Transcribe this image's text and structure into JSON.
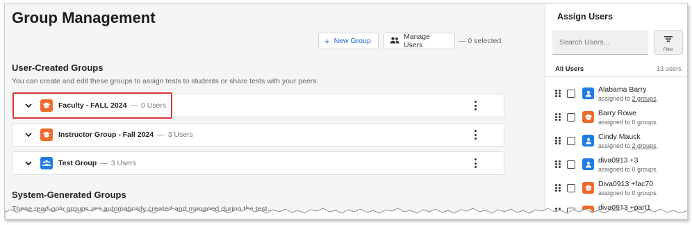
{
  "page": {
    "title": "Group Management",
    "new_group_label": "New Group",
    "manage_users_label": "Manage Users",
    "selected_text": "— 0 selected"
  },
  "user_groups": {
    "title": "User-Created Groups",
    "description": "You can create and edit these groups to assign tests to students or share tests with your peers.",
    "rows": [
      {
        "name": "Faculty - FALL 2024",
        "count": "0 Users",
        "icon": "graduation-cap-icon",
        "color": "#ee6b2d"
      },
      {
        "name": "Instructor Group - Fall 2024",
        "count": "3 Users",
        "icon": "graduation-cap-icon",
        "color": "#ee6b2d"
      },
      {
        "name": "Test Group",
        "count": "3 Users",
        "icon": "people-group-icon",
        "color": "#1f7be6"
      }
    ]
  },
  "system_groups": {
    "title": "System-Generated Groups",
    "description": "These read-only groups are automatically created and managed during the test..."
  },
  "sidebar": {
    "title": "Assign Users",
    "search_placeholder": "Search Users...",
    "filter_label": "Filter",
    "all_users_label": "All Users",
    "user_count": "13 users",
    "users": [
      {
        "name": "Alabama Barry",
        "assigned_prefix": "assigned to ",
        "assigned_link": "2 groups",
        "assigned_suffix": ".",
        "icon": "person-icon",
        "color": "#1f7be6"
      },
      {
        "name": "Barry Rowe",
        "assigned_prefix": "assigned to 0 groups.",
        "assigned_link": "",
        "assigned_suffix": "",
        "icon": "graduation-cap-icon",
        "color": "#ee6b2d"
      },
      {
        "name": "Cindy Mauck",
        "assigned_prefix": "assigned to ",
        "assigned_link": "2 groups",
        "assigned_suffix": ".",
        "icon": "person-icon",
        "color": "#1f7be6"
      },
      {
        "name": "diva0913 +3",
        "assigned_prefix": "assigned to 0 groups.",
        "assigned_link": "",
        "assigned_suffix": "",
        "icon": "person-icon",
        "color": "#1f7be6"
      },
      {
        "name": "Diva0913 +fac70",
        "assigned_prefix": "assigned to 0 groups.",
        "assigned_link": "",
        "assigned_suffix": "",
        "icon": "graduation-cap-icon",
        "color": "#ee6b2d"
      },
      {
        "name": "diva0913 +part1",
        "assigned_prefix": "",
        "assigned_link": "",
        "assigned_suffix": "",
        "icon": "graduation-cap-icon",
        "color": "#ee6b2d"
      }
    ]
  },
  "colors": {
    "accent_blue": "#1a67d2",
    "highlight_red": "#e0393e",
    "orange_icon": "#ee6b2d",
    "blue_icon": "#1f7be6"
  }
}
